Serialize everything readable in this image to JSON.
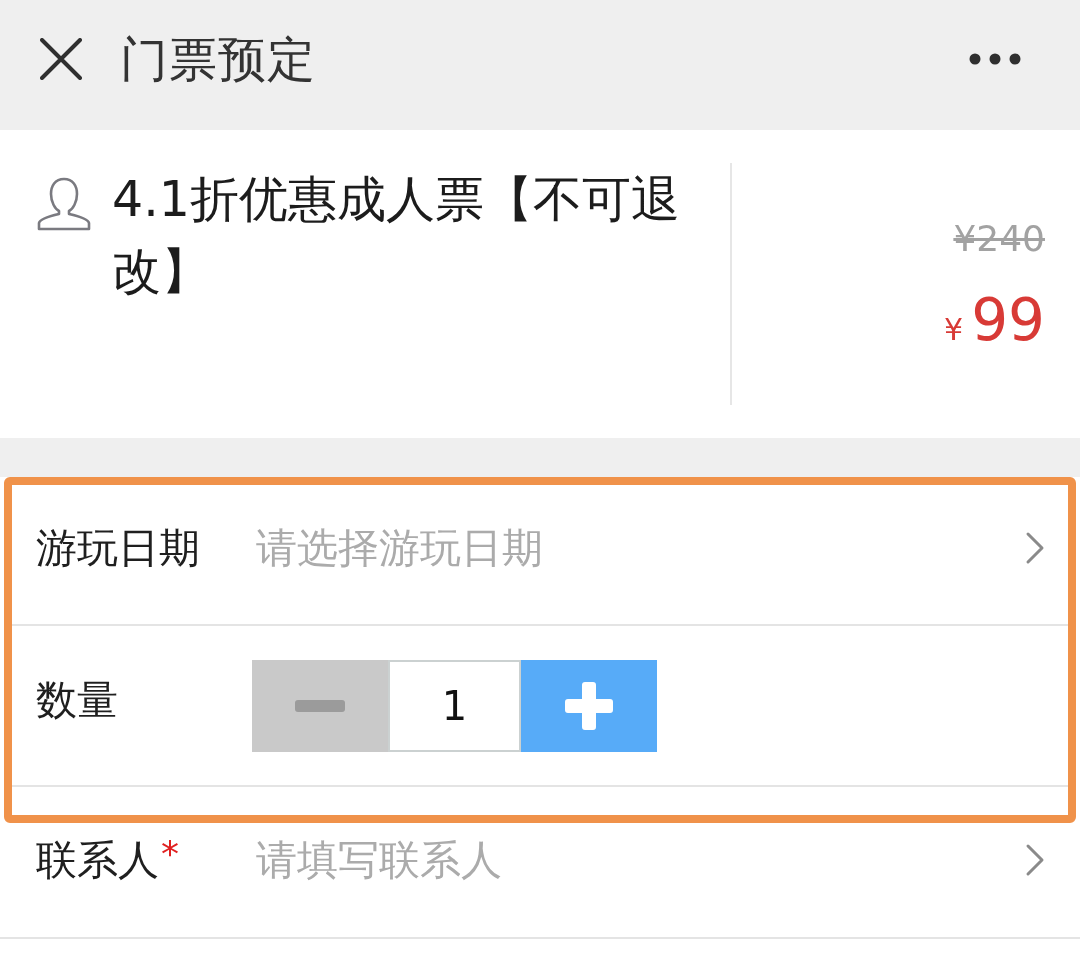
{
  "header": {
    "title": "门票预定"
  },
  "product": {
    "name": "4.1折优惠成人票【不可退改】",
    "original_price": "¥240",
    "price_currency": "¥",
    "price": "99"
  },
  "form": {
    "rows": [
      {
        "kind": "select",
        "label": "游玩日期",
        "placeholder": "请选择游玩日期",
        "highlighted": true
      },
      {
        "kind": "stepper",
        "label": "数量",
        "value": "1",
        "decrease_disabled": true,
        "highlighted": true
      },
      {
        "kind": "select",
        "label": "联系人",
        "required_mark": "*",
        "placeholder": "请填写联系人",
        "highlighted": false
      }
    ]
  }
}
